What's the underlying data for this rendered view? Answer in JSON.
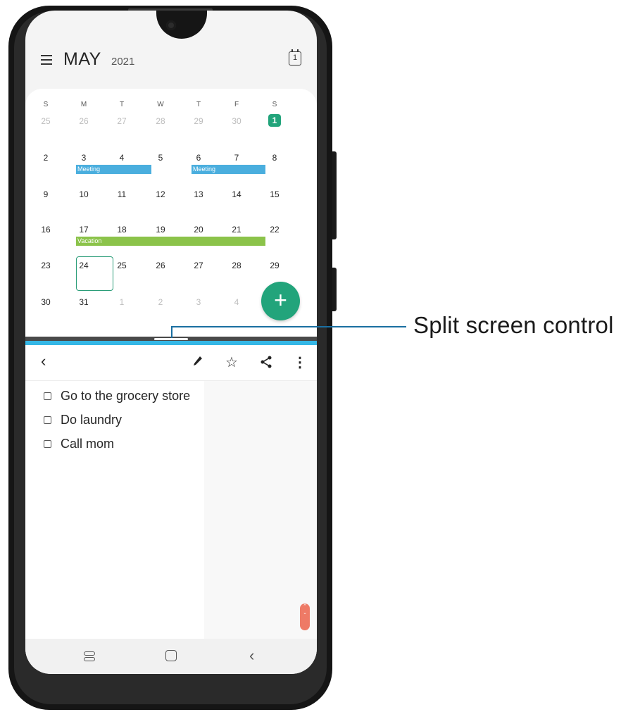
{
  "calendar": {
    "month": "MAY",
    "year": "2021",
    "today_icon_label": "1",
    "weekdays": [
      "S",
      "M",
      "T",
      "W",
      "T",
      "F",
      "S"
    ],
    "rows": [
      [
        "25",
        "26",
        "27",
        "28",
        "29",
        "30",
        "1"
      ],
      [
        "2",
        "3",
        "4",
        "5",
        "6",
        "7",
        "8"
      ],
      [
        "9",
        "10",
        "11",
        "12",
        "13",
        "14",
        "15"
      ],
      [
        "16",
        "17",
        "18",
        "19",
        "20",
        "21",
        "22"
      ],
      [
        "23",
        "24",
        "25",
        "26",
        "27",
        "28",
        "29"
      ],
      [
        "30",
        "31",
        "1",
        "2",
        "3",
        "4",
        ""
      ]
    ],
    "events": {
      "meeting_1": "Meeting",
      "meeting_2": "Meeting",
      "vacation": "Vacation"
    },
    "fab_label": "+"
  },
  "notes": {
    "items": [
      {
        "label": "Go to the grocery store",
        "checked": false
      },
      {
        "label": "Do laundry",
        "checked": false
      },
      {
        "label": "Call mom",
        "checked": false
      }
    ]
  },
  "callout": {
    "label": "Split screen control"
  },
  "colors": {
    "accent_green": "#22a47b",
    "event_blue": "#4aaede",
    "event_green": "#8bc34a",
    "divider_blue": "#35b7e6",
    "scroll_orange": "#ee7a66"
  },
  "icons": [
    "menu-icon",
    "calendar-today-icon",
    "add-icon",
    "back-icon",
    "pencil-icon",
    "star-icon",
    "share-icon",
    "more-icon",
    "recent-apps-icon",
    "home-icon",
    "nav-back-icon"
  ]
}
